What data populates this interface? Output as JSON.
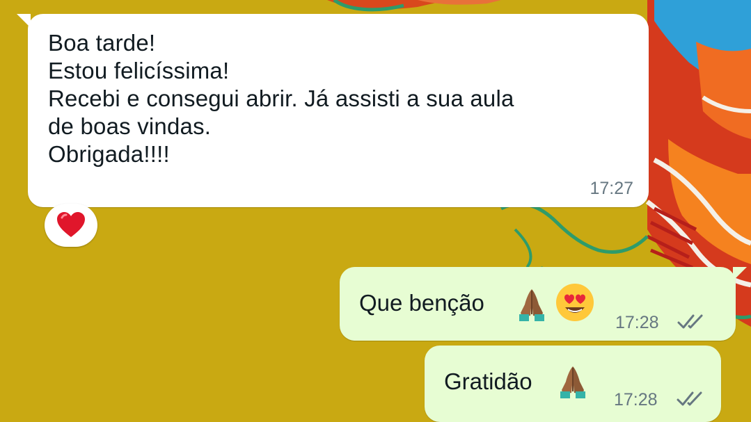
{
  "incoming_message": {
    "lines": [
      "Boa tarde!",
      "Estou felicíssima!",
      "Recebi e consegui abrir. Já assisti a sua aula",
      "de boas vindas.",
      "Obrigada!!!!"
    ],
    "time": "17:27",
    "reaction": "red-heart"
  },
  "outgoing_messages": [
    {
      "text": "Que benção",
      "emojis": [
        "folded-hands-medium-dark-skin",
        "smiling-face-with-heart-eyes"
      ],
      "time": "17:28",
      "status": "delivered"
    },
    {
      "text": "Gratidão",
      "emojis": [
        "folded-hands-medium-dark-skin"
      ],
      "time": "17:28",
      "status": "delivered"
    }
  ],
  "colors": {
    "wallpaper": "#c9a912",
    "incoming_bubble": "#ffffff",
    "outgoing_bubble": "#e7fdd3",
    "text": "#111b21",
    "meta": "#667781",
    "heart": "#e0162b"
  }
}
